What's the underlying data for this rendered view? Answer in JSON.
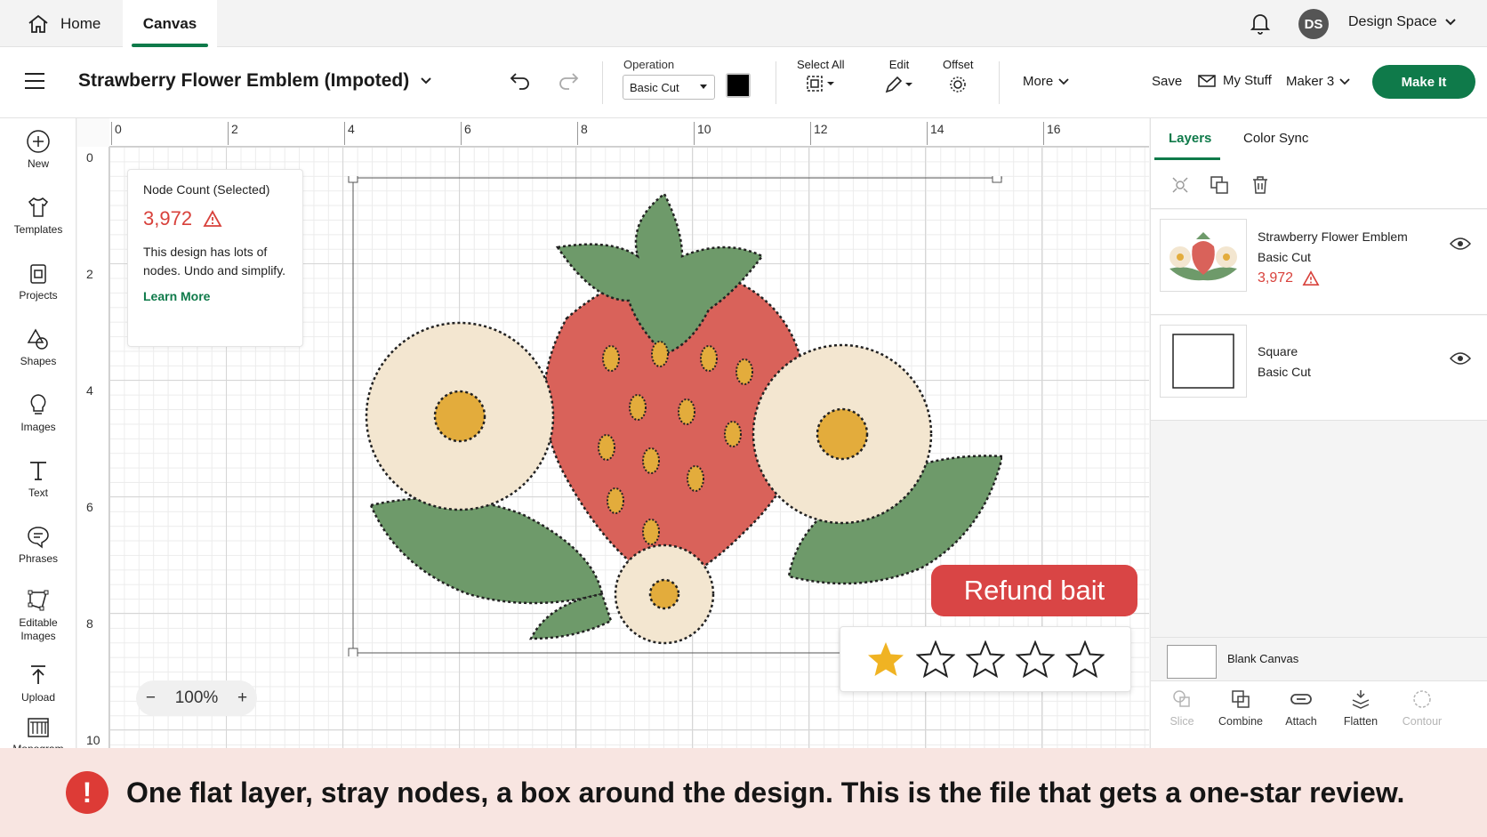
{
  "nav": {
    "home_label": "Home",
    "canvas_label": "Canvas",
    "avatar_initials": "DS",
    "space_label": "Design Space"
  },
  "toolbar": {
    "project_title": "Strawberry Flower Emblem (Impoted)",
    "operation_label": "Operation",
    "operation_value": "Basic Cut",
    "operation_color": "#000000",
    "select_all_label": "Select All",
    "edit_label": "Edit",
    "offset_label": "Offset",
    "more_label": "More",
    "save_label": "Save",
    "my_stuff_label": "My Stuff",
    "machine_label": "Maker 3",
    "make_it_label": "Make It"
  },
  "sidebar": {
    "items": [
      {
        "label": "New",
        "icon": "plus-circle-icon"
      },
      {
        "label": "Templates",
        "icon": "shirt-icon"
      },
      {
        "label": "Projects",
        "icon": "projects-icon"
      },
      {
        "label": "Shapes",
        "icon": "shapes-icon"
      },
      {
        "label": "Images",
        "icon": "lightbulb-icon"
      },
      {
        "label": "Text",
        "icon": "text-icon"
      },
      {
        "label": "Phrases",
        "icon": "speech-bubble-icon"
      },
      {
        "label": "Editable Images",
        "icon": "editable-images-icon"
      },
      {
        "label": "Upload",
        "icon": "upload-icon"
      },
      {
        "label": "Monogram",
        "icon": "monogram-icon"
      }
    ]
  },
  "canvas": {
    "ruler_top": [
      "0",
      "2",
      "4",
      "6",
      "8",
      "10",
      "12",
      "14",
      "16"
    ],
    "ruler_left": [
      "0",
      "2",
      "4",
      "6",
      "8",
      "10"
    ],
    "tooltip": {
      "title": "Node Count (Selected)",
      "count": "3,972",
      "description": "This design has lots of nodes. Undo and simplify.",
      "link": "Learn More"
    },
    "zoom_value": "100%",
    "refund_label": "Refund bait",
    "rating": {
      "value": 1,
      "max": 5,
      "filled_color": "#f0b323"
    }
  },
  "rightpanel": {
    "tabs": [
      "Layers",
      "Color Sync"
    ],
    "layers": [
      {
        "name": "Strawberry Flower Emblem",
        "operation": "Basic Cut",
        "node_count": "3,972"
      },
      {
        "name": "Square",
        "operation": "Basic Cut"
      }
    ],
    "blank_canvas_label": "Blank Canvas",
    "bottom_tools": [
      {
        "label": "Slice",
        "enabled": false
      },
      {
        "label": "Combine",
        "enabled": true
      },
      {
        "label": "Attach",
        "enabled": true
      },
      {
        "label": "Flatten",
        "enabled": true
      },
      {
        "label": "Contour",
        "enabled": false
      }
    ]
  },
  "banner": {
    "text": "One flat layer, stray nodes, a box around the design. This is the file that gets a one-star review."
  },
  "colors": {
    "brand_green": "#0f7a4a",
    "warning_red": "#d8413b",
    "strawberry": "#d9625a",
    "leaf": "#6e9a6a",
    "petal": "#f3e6d0",
    "center": "#e3ac3c"
  }
}
